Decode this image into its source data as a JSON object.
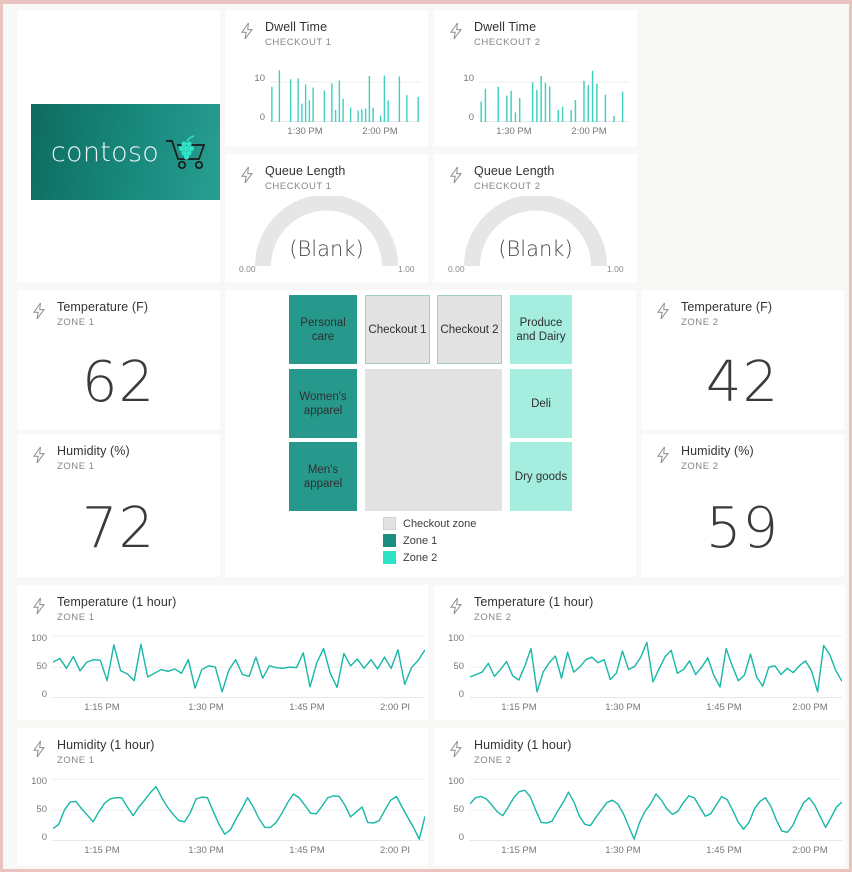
{
  "theme": {
    "accent_teal": "#1BB8A5",
    "zone1_color": "#27998c",
    "zone2_color": "#a5eedf",
    "checkout_zone_color": "#e2e2e2",
    "page_border": "#e8c3c0",
    "card_bg": "#ffffff",
    "gutter": "#f8f8f7"
  },
  "logo": {
    "word": "contoso",
    "mark_icon": "shopping-cart-grapes-icon"
  },
  "dwell": [
    {
      "title": "Dwell Time",
      "subtitle": "CHECKOUT 1",
      "icon": "lightning-bolt-icon",
      "chart_data": {
        "type": "bar",
        "title": "Dwell Time",
        "xlabel": "",
        "ylabel": "",
        "ylim": [
          0,
          13
        ],
        "yticks": [
          0,
          10
        ],
        "xticks": [
          "1:30 PM",
          "2:00 PM"
        ],
        "grid": true,
        "values": [
          8.8,
          0,
          12.9,
          0,
          0,
          10.7,
          0,
          10.9,
          4.6,
          9.4,
          5.4,
          8.6,
          0,
          0,
          7.9,
          0,
          9.7,
          3.0,
          10.4,
          5.8,
          0,
          3.6,
          0,
          2.9,
          3.2,
          3.4,
          11.5,
          3.6,
          0,
          1.6,
          11.6,
          5.4,
          0,
          0,
          11.4,
          0,
          6.7,
          0,
          0,
          6.3
        ]
      }
    },
    {
      "title": "Dwell Time",
      "subtitle": "CHECKOUT 2",
      "icon": "lightning-bolt-icon",
      "chart_data": {
        "type": "bar",
        "title": "Dwell Time",
        "xlabel": "",
        "ylabel": "",
        "ylim": [
          0,
          13
        ],
        "yticks": [
          0,
          10
        ],
        "xticks": [
          "1:30 PM",
          "2:00 PM"
        ],
        "grid": true,
        "values": [
          5.1,
          8.3,
          0,
          0,
          8.8,
          0,
          6.6,
          7.8,
          2.4,
          6.0,
          0,
          0,
          9.9,
          8.0,
          11.5,
          9.8,
          8.9,
          0,
          3.0,
          3.8,
          0,
          3.0,
          5.5,
          0,
          10.3,
          9.2,
          12.8,
          9.6,
          0,
          6.8,
          0,
          1.5,
          0,
          7.6,
          0
        ]
      }
    }
  ],
  "queue": [
    {
      "title": "Queue Length",
      "subtitle": "CHECKOUT 1",
      "icon": "lightning-bolt-icon",
      "value_text": "(Blank)",
      "min_label": "0.00",
      "max_label": "1.00",
      "chart_data": {
        "type": "gauge",
        "title": "Queue Length",
        "value": null,
        "min": 0,
        "max": 1,
        "value_display": "(Blank)"
      }
    },
    {
      "title": "Queue Length",
      "subtitle": "CHECKOUT 2",
      "icon": "lightning-bolt-icon",
      "value_text": "(Blank)",
      "min_label": "0.00",
      "max_label": "1.00",
      "chart_data": {
        "type": "gauge",
        "title": "Queue Length",
        "value": null,
        "min": 0,
        "max": 1,
        "value_display": "(Blank)"
      }
    }
  ],
  "kpis": [
    {
      "title": "Temperature (F)",
      "subtitle": "ZONE 1",
      "icon": "lightning-bolt-icon",
      "value": "62"
    },
    {
      "title": "Humidity (%)",
      "subtitle": "ZONE 1",
      "icon": "lightning-bolt-icon",
      "value": "72"
    },
    {
      "title": "Temperature (F)",
      "subtitle": "ZONE 2",
      "icon": "lightning-bolt-icon",
      "value": "42"
    },
    {
      "title": "Humidity (%)",
      "subtitle": "ZONE 2",
      "icon": "lightning-bolt-icon",
      "value": "59"
    }
  ],
  "storemap": {
    "tiles": [
      {
        "label": "Personal care",
        "zone": "zone1"
      },
      {
        "label": "Women's apparel",
        "zone": "zone1"
      },
      {
        "label": "Men's apparel",
        "zone": "zone1"
      },
      {
        "label": "Checkout 1",
        "zone": "checkout"
      },
      {
        "label": "Checkout 2",
        "zone": "checkout"
      },
      {
        "label": "Produce and Dairy",
        "zone": "zone2"
      },
      {
        "label": "Deli",
        "zone": "zone2"
      },
      {
        "label": "Dry goods",
        "zone": "zone2"
      }
    ],
    "legend": [
      {
        "label": "Checkout zone",
        "color": "#e2e2e2"
      },
      {
        "label": "Zone 1",
        "color": "#1a8f80"
      },
      {
        "label": "Zone 2",
        "color": "#2fe3c6"
      }
    ]
  },
  "trends": [
    {
      "title": "Temperature (1 hour)",
      "subtitle": "ZONE 1",
      "icon": "lightning-bolt-icon",
      "chart_data": {
        "type": "line",
        "title": "Temperature (1 hour)",
        "xlabel": "",
        "ylabel": "",
        "ylim": [
          0,
          110
        ],
        "yticks": [
          0,
          50,
          100
        ],
        "xticks": [
          "1:15 PM",
          "1:30 PM",
          "1:45 PM",
          "2:00 PI"
        ],
        "grid": true,
        "line_color": "#17b7a6",
        "values": [
          58,
          64,
          48,
          67,
          44,
          58,
          62,
          61,
          28,
          86,
          44,
          39,
          28,
          87,
          34,
          40,
          46,
          43,
          47,
          40,
          62,
          16,
          46,
          52,
          50,
          10,
          45,
          62,
          38,
          35,
          66,
          32,
          52,
          49,
          48,
          50,
          49,
          73,
          18,
          57,
          80,
          40,
          17,
          72,
          52,
          63,
          48,
          62,
          47,
          66,
          48,
          78,
          22,
          49,
          61,
          78
        ]
      }
    },
    {
      "title": "Temperature (1 hour)",
      "subtitle": "ZONE 2",
      "icon": "lightning-bolt-icon",
      "chart_data": {
        "type": "line",
        "title": "Temperature (1 hour)",
        "xlabel": "",
        "ylabel": "",
        "ylim": [
          0,
          110
        ],
        "yticks": [
          0,
          50,
          100
        ],
        "xticks": [
          "1:15 PM",
          "1:30 PM",
          "1:45 PM",
          "2:00 PM"
        ],
        "grid": true,
        "line_color": "#17b7a6",
        "values": [
          34,
          38,
          42,
          56,
          35,
          46,
          59,
          36,
          29,
          52,
          80,
          10,
          42,
          57,
          68,
          32,
          74,
          42,
          50,
          62,
          66,
          57,
          62,
          30,
          40,
          76,
          46,
          51,
          66,
          90,
          26,
          47,
          67,
          77,
          40,
          46,
          60,
          38,
          50,
          65,
          36,
          18,
          80,
          52,
          28,
          37,
          71,
          34,
          19,
          50,
          52,
          38,
          48,
          41,
          52,
          60,
          44,
          10,
          85,
          70,
          44,
          27
        ]
      }
    },
    {
      "title": "Humidity (1 hour)",
      "subtitle": "ZONE 1",
      "icon": "lightning-bolt-icon",
      "chart_data": {
        "type": "line",
        "title": "Humidity (1 hour)",
        "xlabel": "",
        "ylabel": "",
        "ylim": [
          0,
          110
        ],
        "yticks": [
          0,
          50,
          100
        ],
        "xticks": [
          "1:15 PM",
          "1:30 PM",
          "1:45 PM",
          "2:00 PI"
        ],
        "grid": true,
        "line_color": "#17b7a6",
        "values": [
          20,
          27,
          50,
          63,
          64,
          52,
          42,
          31,
          47,
          61,
          68,
          70,
          70,
          55,
          41,
          55,
          66,
          78,
          88,
          70,
          55,
          43,
          33,
          31,
          46,
          68,
          71,
          70,
          48,
          27,
          11,
          18,
          36,
          52,
          70,
          55,
          36,
          22,
          22,
          30,
          45,
          62,
          76,
          70,
          58,
          45,
          44,
          56,
          70,
          73,
          72,
          58,
          39,
          47,
          55,
          30,
          29,
          33,
          50,
          66,
          72,
          55,
          38,
          22,
          3,
          40
        ]
      }
    },
    {
      "title": "Humidity (1 hour)",
      "subtitle": "ZONE 2",
      "icon": "lightning-bolt-icon",
      "chart_data": {
        "type": "line",
        "title": "Humidity (1 hour)",
        "xlabel": "",
        "ylabel": "",
        "ylim": [
          0,
          110
        ],
        "yticks": [
          0,
          50,
          100
        ],
        "xticks": [
          "1:15 PM",
          "1:30 PM",
          "1:45 PM",
          "2:00 PM"
        ],
        "grid": true,
        "line_color": "#17b7a6",
        "values": [
          60,
          70,
          72,
          68,
          58,
          47,
          41,
          55,
          70,
          80,
          82,
          72,
          50,
          30,
          29,
          32,
          48,
          62,
          79,
          63,
          40,
          27,
          25,
          38,
          50,
          62,
          66,
          60,
          45,
          24,
          3,
          30,
          48,
          60,
          76,
          66,
          52,
          43,
          48,
          62,
          73,
          70,
          55,
          40,
          44,
          58,
          72,
          67,
          50,
          31,
          19,
          30,
          52,
          64,
          70,
          56,
          34,
          16,
          14,
          25,
          45,
          62,
          70,
          58,
          40,
          22,
          38,
          55,
          63
        ]
      }
    }
  ]
}
